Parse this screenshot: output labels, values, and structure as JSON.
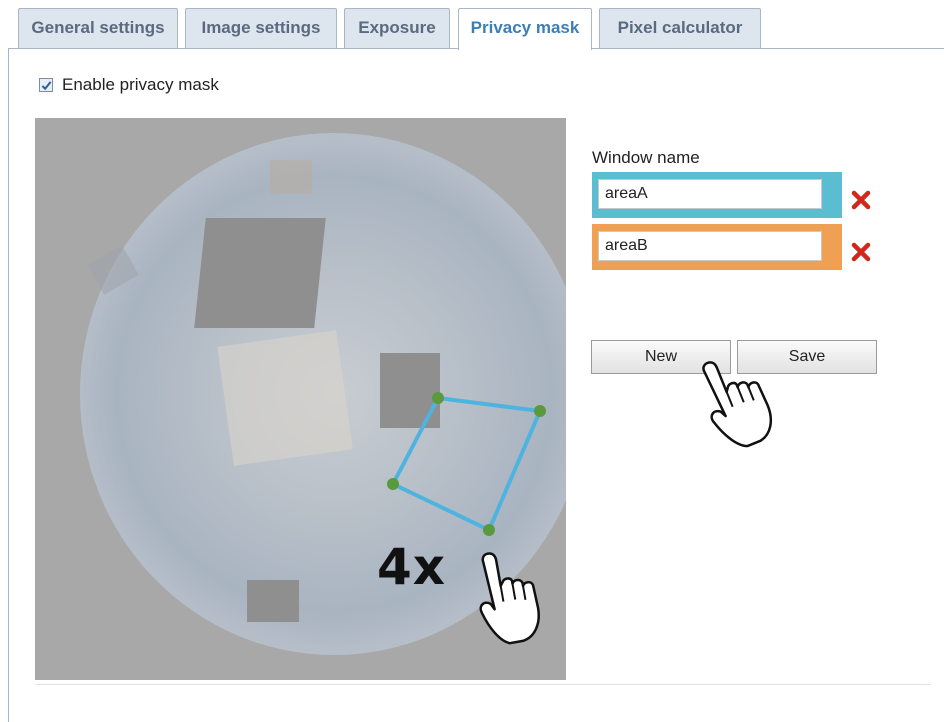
{
  "tabs": [
    {
      "label": "General settings",
      "active": false
    },
    {
      "label": "Image settings",
      "active": false
    },
    {
      "label": "Exposure",
      "active": false
    },
    {
      "label": "Privacy mask",
      "active": true
    },
    {
      "label": "Pixel calculator",
      "active": false
    }
  ],
  "enable": {
    "label": "Enable privacy mask",
    "checked": true
  },
  "window_list": {
    "label": "Window name",
    "windows": [
      {
        "name": "areaA",
        "color": "#5bbdd0"
      },
      {
        "name": "areaB",
        "color": "#f0a052"
      }
    ]
  },
  "buttons": {
    "new_label": "New",
    "save_label": "Save"
  },
  "annotation": {
    "click_count": "4x",
    "polygon_color": "#4fb3e0",
    "vertex_color": "#5a9a3c"
  },
  "icons": {
    "checkbox": "checkmark-icon",
    "delete": "red-x-icon",
    "pointer": "hand-pointer-icon"
  }
}
